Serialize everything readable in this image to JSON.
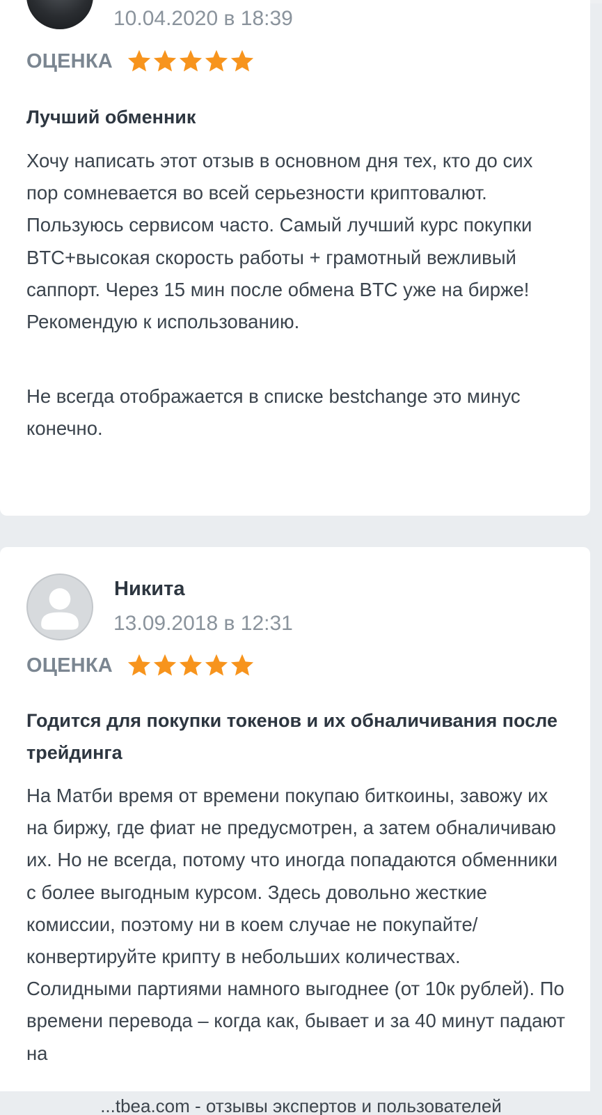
{
  "reviews": [
    {
      "date": "10.04.2020 в 18:39",
      "rating_label": "ОЦЕНКА",
      "stars": 5,
      "title": "Лучший обменник",
      "text": "Хочу написать этот отзыв в основном дня тех, кто до сих пор сомневается во всей серьезности криптовалют. Пользуюсь сервисом часто. Самый лучший курс покупки BTC+высокая скорость работы + грамотный вежливый саппорт. Через 15 мин после обмена BTC уже на бирже! Рекомендую к использованию.",
      "text2": "Не всегда отображается в списке bestchange это минус конечно."
    },
    {
      "author": "Никита",
      "date": "13.09.2018 в 12:31",
      "rating_label": "ОЦЕНКА",
      "stars": 5,
      "title": "Годится для покупки токенов и их обналичивания после трейдинга",
      "text": "На Матби время от времени покупаю биткоины, завожу их на биржу, где фиат не предусмотрен, а затем обналичиваю их. Но не всегда, потому что иногда попадаются обменники с более выгодным курсом. Здесь довольно жесткие комиссии, поэтому ни в коем случае не покупайте/конвертируйте крипту в небольших количествах. Солидными партиями намного выгоднее (от 10к рублей). По времени перевода – когда как, бывает и за 40 минут падают на"
    }
  ],
  "footer": "...tbea.com - отзывы экспертов и пользователей",
  "colors": {
    "star": "#f7941d",
    "background": "#eaedf0",
    "card": "#ffffff",
    "muted_text": "#8a939c"
  }
}
